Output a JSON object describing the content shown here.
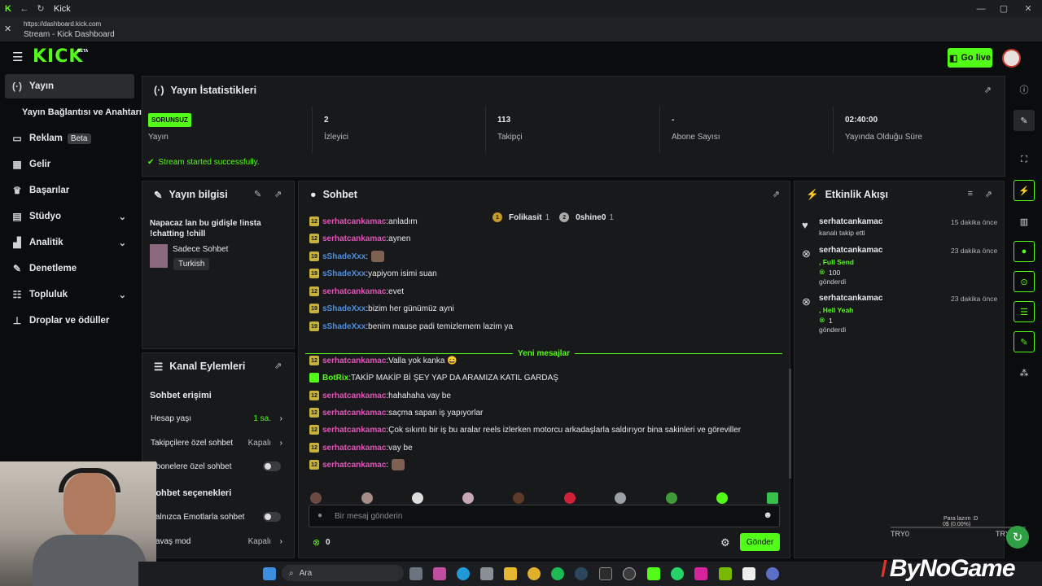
{
  "browser": {
    "tab_title": "Kick",
    "url": "https://dashboard.kick.com",
    "page_title": "Stream - Kick Dashboard"
  },
  "brand": {
    "logo": "KICK",
    "beta": "BETA",
    "accent": "#53fc18"
  },
  "header": {
    "go_live": "Go live"
  },
  "sidebar": {
    "items": [
      {
        "label": "Yayın",
        "icon": "broadcast-icon"
      },
      {
        "label": "Yayın Bağlantısı ve Anahtarı"
      },
      {
        "label": "Reklam",
        "badge": "Beta",
        "icon": "ad-icon"
      },
      {
        "label": "Gelir",
        "icon": "revenue-icon"
      },
      {
        "label": "Başarılar",
        "icon": "trophy-icon"
      },
      {
        "label": "Stüdyo",
        "icon": "studio-icon"
      },
      {
        "label": "Analitik",
        "icon": "analytics-icon"
      },
      {
        "label": "Denetleme",
        "icon": "wrench-icon"
      },
      {
        "label": "Topluluk",
        "icon": "community-icon"
      },
      {
        "label": "Droplar ve ödüller",
        "icon": "drops-icon"
      }
    ]
  },
  "stats": {
    "title": "Yayın İstatistikleri",
    "status_tag": "SORUNSUZ",
    "status_label": "Yayın",
    "viewers": "2",
    "viewers_label": "İzleyici",
    "followers": "113",
    "followers_label": "Takipçi",
    "subs": "-",
    "subs_label": "Abone Sayısı",
    "uptime": "02:40:00",
    "uptime_label": "Yayında Olduğu Süre",
    "message": "Stream started successfully."
  },
  "info": {
    "title": "Yayın bilgisi",
    "stream_title": "Napacaz lan bu gidişle !insta !chatting !chill",
    "category": "Sadece Sohbet",
    "language": "Turkish"
  },
  "actions": {
    "title": "Kanal Eylemleri",
    "section1": "Sohbet erişimi",
    "account_age": "Hesap yaşı",
    "account_age_value": "1 sa.",
    "followers_only": "Takipçilere özel sohbet",
    "followers_only_value": "Kapalı",
    "subs_only": "Abonelere özel sohbet",
    "section2": "Sohbet seçenekleri",
    "emote_only": "Yalnızca Emotlarla sohbet",
    "slow_mode": "Yavaş mod",
    "slow_mode_value": "Kapalı"
  },
  "chat": {
    "title": "Sohbet",
    "top1": "Folikasit",
    "top1_n": "1",
    "top2": "0shine0",
    "top2_n": "1",
    "new_messages": "Yeni mesajlar",
    "messages": [
      {
        "lvl": "12",
        "user": "serhatcankamac",
        "color": "#e056b8",
        "text": "anladım"
      },
      {
        "lvl": "12",
        "user": "serhatcankamac",
        "color": "#e056b8",
        "text": "aynen"
      },
      {
        "lvl": "19",
        "user": "sShadeXxx",
        "color": "#4d8fe0",
        "text": ""
      },
      {
        "lvl": "19",
        "user": "sShadeXxx",
        "color": "#4d8fe0",
        "text": "yapiyom isimi suan"
      },
      {
        "lvl": "12",
        "user": "serhatcankamac",
        "color": "#e056b8",
        "text": "evet"
      },
      {
        "lvl": "19",
        "user": "sShadeXxx",
        "color": "#4d8fe0",
        "text": "bizim her günümüz ayni"
      },
      {
        "lvl": "19",
        "user": "sShadeXxx",
        "color": "#4d8fe0",
        "text": "benim mause padi temizlemem lazim ya"
      },
      {
        "lvl": "12",
        "user": "serhatcankamac",
        "color": "#e056b8",
        "text": "Valla yok kanka 😄"
      },
      {
        "lvl": "",
        "user": "BotRix",
        "color": "#53fc18",
        "text": "TAKİP MAKİP Bİ ŞEY YAP DA ARAMIZA KATIL GARDAŞ"
      },
      {
        "lvl": "12",
        "user": "serhatcankamac",
        "color": "#e056b8",
        "text": "hahahaha vay be"
      },
      {
        "lvl": "12",
        "user": "serhatcankamac",
        "color": "#e056b8",
        "text": "saçma sapan iş yapıyorlar"
      },
      {
        "lvl": "12",
        "user": "serhatcankamac",
        "color": "#e056b8",
        "text": "Çok sıkıntı bir iş bu aralar reels izlerken motorcu arkadaşlarla saldırıyor bina sakinleri ve göreviller"
      },
      {
        "lvl": "12",
        "user": "serhatcankamac",
        "color": "#e056b8",
        "text": "vay be"
      },
      {
        "lvl": "12",
        "user": "serhatcankamac",
        "color": "#e056b8",
        "text": ""
      }
    ],
    "placeholder": "Bir mesaj gönderin",
    "points": "0",
    "send": "Gönder"
  },
  "events": {
    "title": "Etkinlik Akışı",
    "items": [
      {
        "user": "serhatcankamac",
        "time": "15 dakika önce",
        "line": "kanalı takip etti",
        "reward": "",
        "amount": "",
        "suffix": ""
      },
      {
        "user": "serhatcankamac",
        "time": "23 dakika önce",
        "line": "",
        "reward": ", Full Send",
        "amount": "100",
        "suffix": "gönderdi"
      },
      {
        "user": "serhatcankamac",
        "time": "23 dakika önce",
        "line": "",
        "reward": ", Hell Yeah",
        "amount": "1",
        "suffix": "gönderdi"
      }
    ]
  },
  "overlay": {
    "ticker_label": "Para lazım :D",
    "ticker_value": "0$ (0.00%)",
    "ticker_left": "TRY0",
    "ticker_right": "TRY",
    "watermark": "ByNoGame"
  },
  "taskbar": {
    "search": "Ara"
  }
}
